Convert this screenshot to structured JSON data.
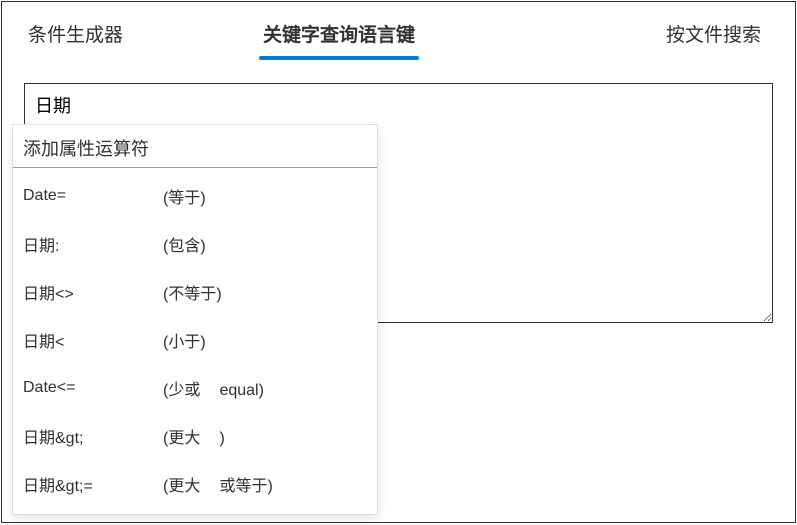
{
  "tabs": {
    "t1": "条件生成器",
    "t2": "关键字查询语言键",
    "t3": "按文件搜索"
  },
  "query": {
    "value": "日期"
  },
  "dropdown": {
    "header": "添加属性运算符",
    "items": [
      {
        "key": "Date=",
        "desc_open": "(等于)",
        "desc_mid": "",
        "desc_close": ""
      },
      {
        "key": "日期:",
        "desc_open": "(包含)",
        "desc_mid": "",
        "desc_close": ""
      },
      {
        "key": "日期<>",
        "desc_open": "(不等于)",
        "desc_mid": "",
        "desc_close": ""
      },
      {
        "key": "日期<",
        "desc_open": "(小于)",
        "desc_mid": "",
        "desc_close": ""
      },
      {
        "key": "Date<=",
        "desc_open": "(少或",
        "desc_mid": "equal",
        "desc_close": ")"
      },
      {
        "key": "日期&gt;",
        "desc_open": "(更大",
        "desc_mid": "",
        "desc_close": ")"
      },
      {
        "key": "日期&gt;=",
        "desc_open": "(更大",
        "desc_mid": "或等于",
        "desc_close": ")"
      }
    ]
  }
}
